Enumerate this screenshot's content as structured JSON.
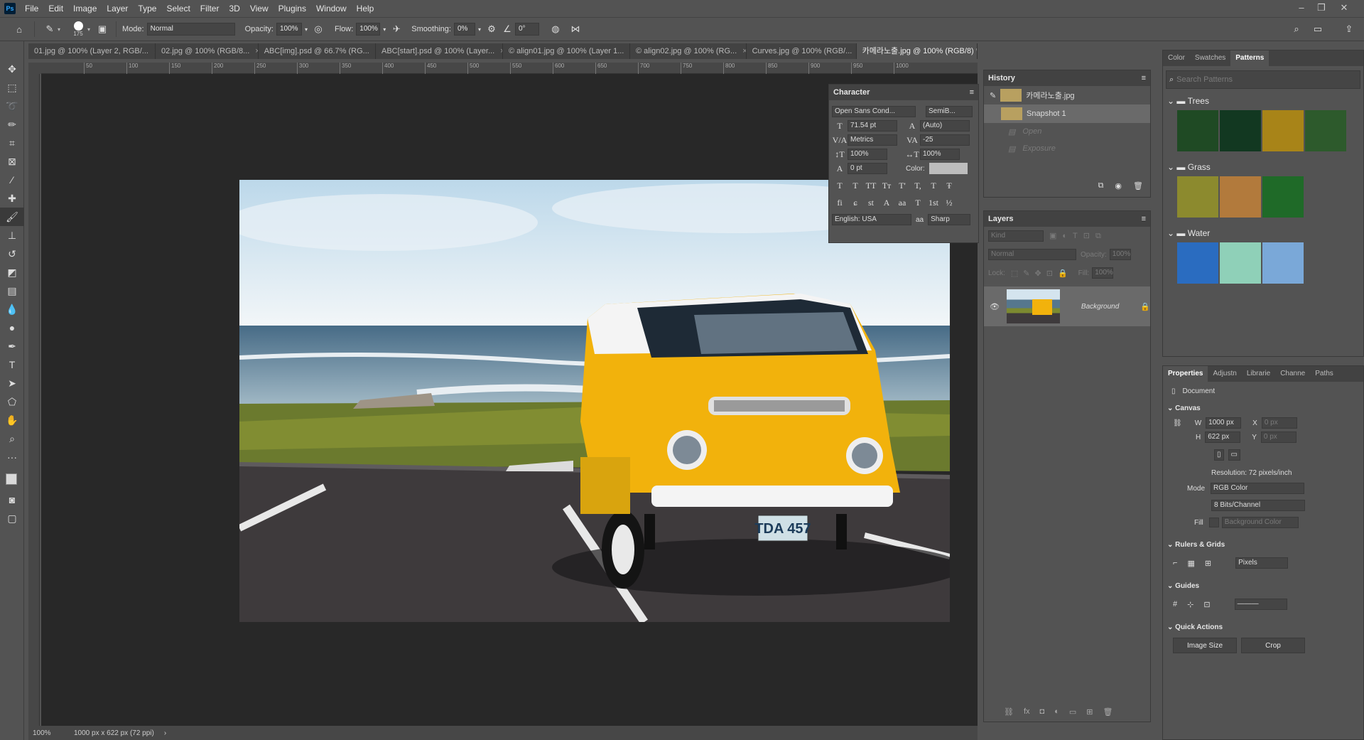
{
  "menu": [
    "File",
    "Edit",
    "Image",
    "Layer",
    "Type",
    "Select",
    "Filter",
    "3D",
    "View",
    "Plugins",
    "Window",
    "Help"
  ],
  "options": {
    "brush_size": "175",
    "mode_label": "Mode:",
    "mode": "Normal",
    "opacity_label": "Opacity:",
    "opacity": "100%",
    "flow_label": "Flow:",
    "flow": "100%",
    "smoothing_label": "Smoothing:",
    "smoothing": "0%",
    "angle": "0°"
  },
  "tabs": [
    {
      "label": "01.jpg @ 100% (Layer 2, RGB/..."
    },
    {
      "label": "02.jpg @ 100% (RGB/8..."
    },
    {
      "label": "ABC[img].psd @ 66.7% (RG..."
    },
    {
      "label": "ABC[start].psd @ 100% (Layer..."
    },
    {
      "label": "© align01.jpg @ 100% (Layer 1..."
    },
    {
      "label": "© align02.jpg @ 100% (RG..."
    },
    {
      "label": "Curves.jpg @ 100% (RGB/..."
    },
    {
      "label": "카메라노출.jpg @ 100% (RGB/8) *"
    }
  ],
  "ruler_h": [
    "50",
    "100",
    "150",
    "200",
    "250",
    "300",
    "350",
    "400",
    "450",
    "500",
    "550",
    "600",
    "650",
    "700",
    "750",
    "800",
    "850",
    "900",
    "950",
    "1000"
  ],
  "status": {
    "zoom": "100%",
    "doc": "1000 px x 622 px (72 ppi)"
  },
  "character": {
    "title": "Character",
    "font": "Open Sans Cond...",
    "style": "SemiB...",
    "size": "71.54 pt",
    "leading": "(Auto)",
    "kerning": "Metrics",
    "tracking": "-25",
    "vscale": "100%",
    "hscale": "100%",
    "baseline": "0 pt",
    "color_label": "Color:",
    "language": "English: USA",
    "aa_label": "aa",
    "antialias": "Sharp",
    "glyphs_row1": [
      "T",
      "T",
      "TT",
      "Tт",
      "T'",
      "T,",
      "T",
      "Ŧ"
    ],
    "glyphs_row2": [
      "fi",
      "ɕ",
      "st",
      "A",
      "aa",
      "T",
      "1st",
      "½"
    ]
  },
  "history": {
    "title": "History",
    "items": [
      "카메라노출.jpg",
      "Snapshot 1",
      "Open",
      "Exposure"
    ]
  },
  "layers": {
    "title": "Layers",
    "filter": "Kind",
    "blend": "Normal",
    "opacity_label": "Opacity:",
    "opacity": "100%",
    "lock_label": "Lock:",
    "fill_label": "Fill:",
    "fill": "100%",
    "layer_name": "Background"
  },
  "patterns": {
    "tabs": [
      "Color",
      "Swatches",
      "Patterns"
    ],
    "search": "Search Patterns",
    "groups": [
      {
        "name": "Trees",
        "colors": [
          "#1f4a24",
          "#123821",
          "#a88418",
          "#2d5a2c"
        ]
      },
      {
        "name": "Grass",
        "colors": [
          "#8c8a2e",
          "#b27a3c",
          "#1f6a28"
        ]
      },
      {
        "name": "Water",
        "colors": [
          "#2a6cc0",
          "#8fd0b8",
          "#7aa8d8"
        ]
      }
    ]
  },
  "properties": {
    "tabs": [
      "Properties",
      "Adjustn",
      "Librarie",
      "Channe",
      "Paths"
    ],
    "doc_label": "Document",
    "canvas": "Canvas",
    "w_label": "W",
    "w": "1000 px",
    "h_label": "H",
    "h": "622 px",
    "x_label": "X",
    "x": "0 px",
    "y_label": "Y",
    "y": "0 px",
    "resolution": "Resolution: 72 pixels/inch",
    "mode_label": "Mode",
    "mode": "RGB Color",
    "bits": "8 Bits/Channel",
    "fill_label": "Fill",
    "fill": "Background Color",
    "rulers": "Rulers & Grids",
    "units": "Pixels",
    "guides": "Guides",
    "quick": "Quick Actions",
    "image_size": "Image Size",
    "crop": "Crop"
  },
  "photo": {
    "plate": "TDA 457"
  },
  "colors": {
    "accent": "#31a8ff",
    "bg": "#535353",
    "canvas": "#282828"
  }
}
